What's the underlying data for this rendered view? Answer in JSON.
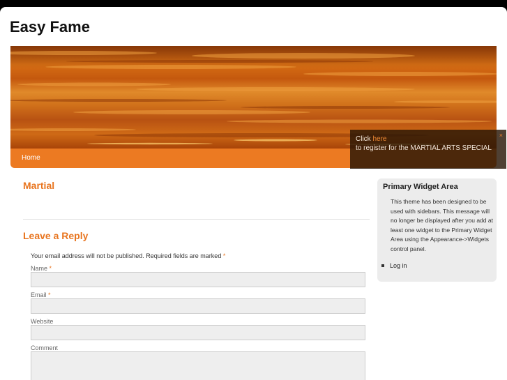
{
  "site": {
    "title": "Easy Fame"
  },
  "nav": {
    "home": "Home"
  },
  "popup": {
    "prefix": "Click ",
    "link": "here",
    "message": "to register for the MARTIAL ARTS SPECIAL",
    "close": "×"
  },
  "post": {
    "title": "Martial"
  },
  "reply": {
    "title": "Leave a Reply",
    "notes": "Your email address will not be published. Required fields are marked ",
    "required_mark": "*",
    "fields": {
      "name": "Name",
      "email": "Email",
      "website": "Website",
      "comment": "Comment"
    }
  },
  "sidebar": {
    "title": "Primary Widget Area",
    "text": "This theme has been designed to be used with sidebars. This message will no longer be displayed after you add at least one widget to the Primary Widget Area using the Appearance->Widgets control panel.",
    "links": [
      "Log in"
    ]
  },
  "colors": {
    "accent": "#e8741e",
    "nav": "#ec7a22",
    "page_bg": "#000000"
  },
  "icons": {
    "close": "close-icon",
    "bullet": "bullet-icon"
  }
}
